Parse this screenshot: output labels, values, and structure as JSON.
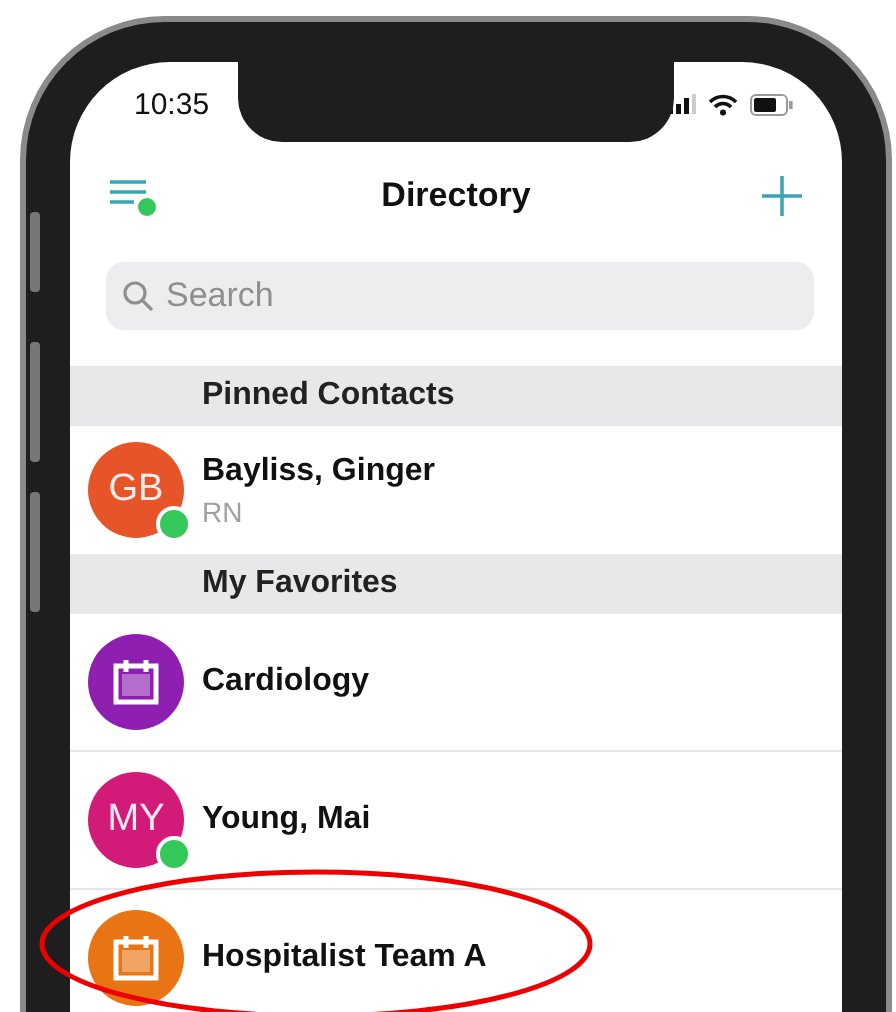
{
  "status_bar": {
    "time": "10:35"
  },
  "header": {
    "title": "Directory",
    "menu_badge": true
  },
  "search": {
    "placeholder": "Search"
  },
  "sections": [
    {
      "title": "Pinned Contacts",
      "items": [
        {
          "kind": "person",
          "name": "Bayliss, Ginger",
          "subtitle": "RN",
          "initials": "GB",
          "color": "#e8542a",
          "online": true
        }
      ]
    },
    {
      "title": "My Favorites",
      "items": [
        {
          "kind": "group",
          "name": "Cardiology",
          "color": "#8e1fb0"
        },
        {
          "kind": "person",
          "name": "Young, Mai",
          "initials": "MY",
          "color": "#d21a78",
          "online": true
        },
        {
          "kind": "group",
          "name": "Hospitalist Team A",
          "color": "#e87414"
        }
      ]
    }
  ]
}
